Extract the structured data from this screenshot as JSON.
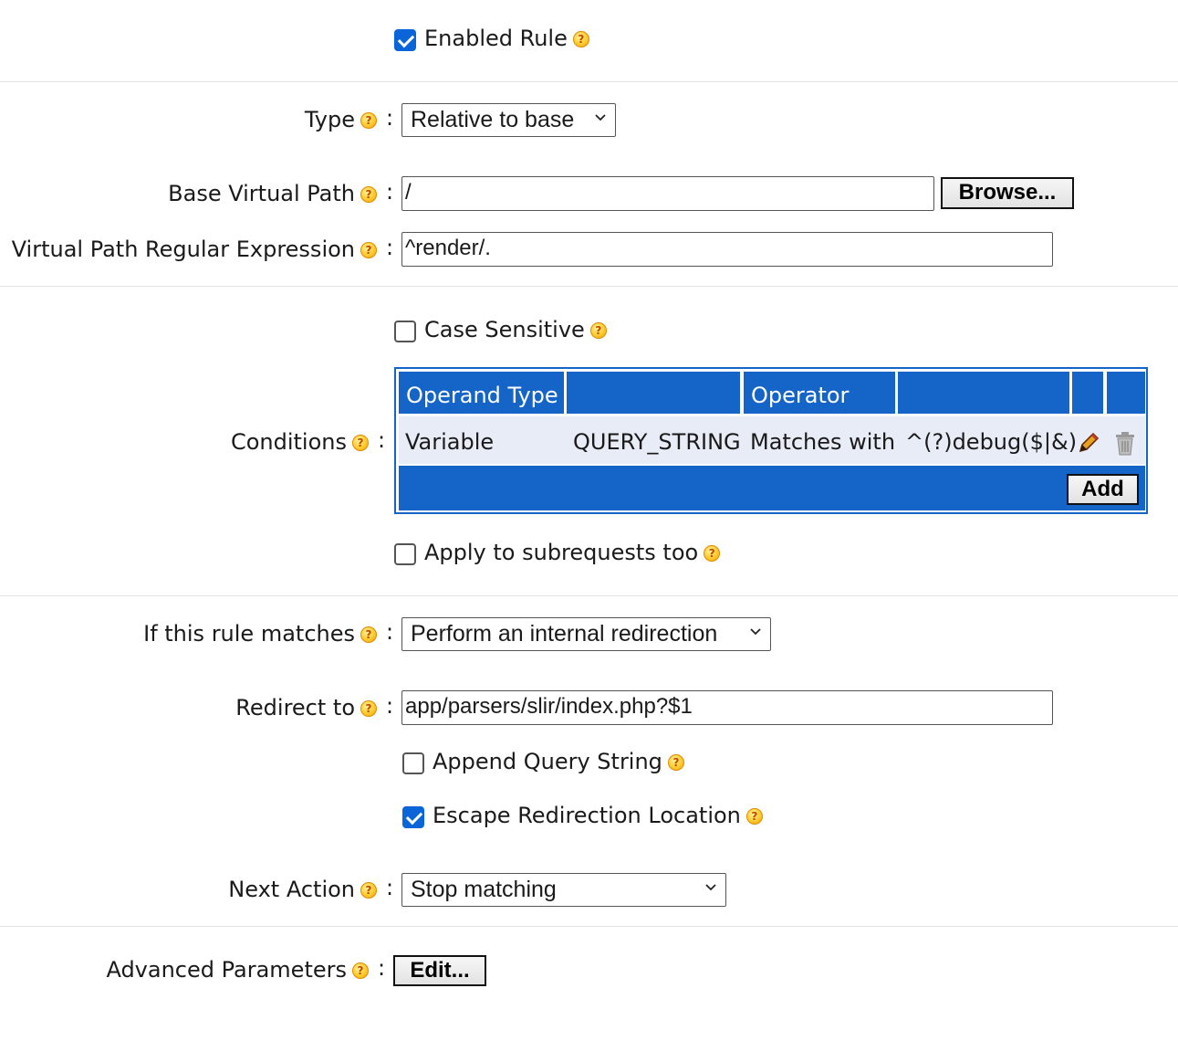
{
  "enabled_rule": {
    "label": "Enabled Rule",
    "checked": true
  },
  "type": {
    "label": "Type",
    "value": "Relative to base"
  },
  "base_path": {
    "label": "Base Virtual Path",
    "value": "/",
    "browse_label": "Browse..."
  },
  "regex": {
    "label": "Virtual Path Regular Expression",
    "value": "^render/."
  },
  "case_sensitive": {
    "label": "Case Sensitive",
    "checked": false
  },
  "conditions": {
    "label": "Conditions",
    "headers": [
      "Operand Type",
      "",
      "Operator",
      "",
      "",
      ""
    ],
    "rows": [
      {
        "operand_type": "Variable",
        "operand": "QUERY_STRING",
        "operator": "Matches with",
        "value": "^(?)debug($|&)"
      }
    ],
    "add_label": "Add"
  },
  "apply_subrequests": {
    "label": "Apply to subrequests too",
    "checked": false
  },
  "rule_matches": {
    "label": "If this rule matches",
    "value": "Perform an internal redirection"
  },
  "redirect_to": {
    "label": "Redirect to",
    "value": "app/parsers/slir/index.php?$1"
  },
  "append_query": {
    "label": "Append Query String",
    "checked": false
  },
  "escape_redirect": {
    "label": "Escape Redirection Location",
    "checked": true
  },
  "next_action": {
    "label": "Next Action",
    "value": "Stop matching"
  },
  "advanced": {
    "label": "Advanced Parameters",
    "button_label": "Edit..."
  },
  "help_glyph": "?",
  "colon": ":",
  "colors": {
    "accent": "#1565c8",
    "checkbox": "#0a66d8",
    "help_icon": "#ffd23d"
  }
}
